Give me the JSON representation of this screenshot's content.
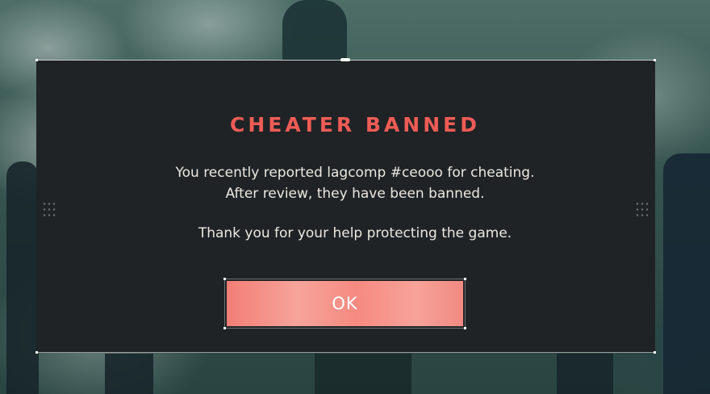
{
  "dialog": {
    "title": "CHEATER BANNED",
    "message_line_1": "You recently reported lagcomp #ceooo for cheating.",
    "message_line_2": "After review, they have been banned.",
    "message_line_3": "Thank you for your help protecting the game.",
    "ok_label": "OK"
  },
  "colors": {
    "title": "#ee5c55",
    "button": "#f6948b",
    "dialog_background": "#1f2326",
    "text": "#ece8e1"
  }
}
